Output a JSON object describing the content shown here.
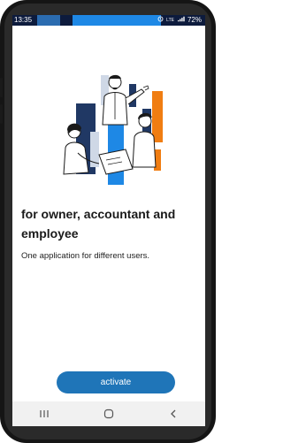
{
  "status_bar": {
    "time": "13:35",
    "network_label": "LTE",
    "battery": "72%"
  },
  "onboarding": {
    "headline": "for owner, accountant and employee",
    "subtitle": "One application for different users."
  },
  "actions": {
    "activate_label": "activate"
  },
  "nav_bar": {
    "items": [
      "recent-apps-icon",
      "home-icon",
      "back-icon"
    ]
  },
  "colors": {
    "accent_blue": "#1f75b8",
    "illustration_orange": "#f07d12",
    "illustration_navy": "#203864",
    "illustration_blue": "#1e88e5",
    "status_bar_bg": "#0d1b3d"
  }
}
